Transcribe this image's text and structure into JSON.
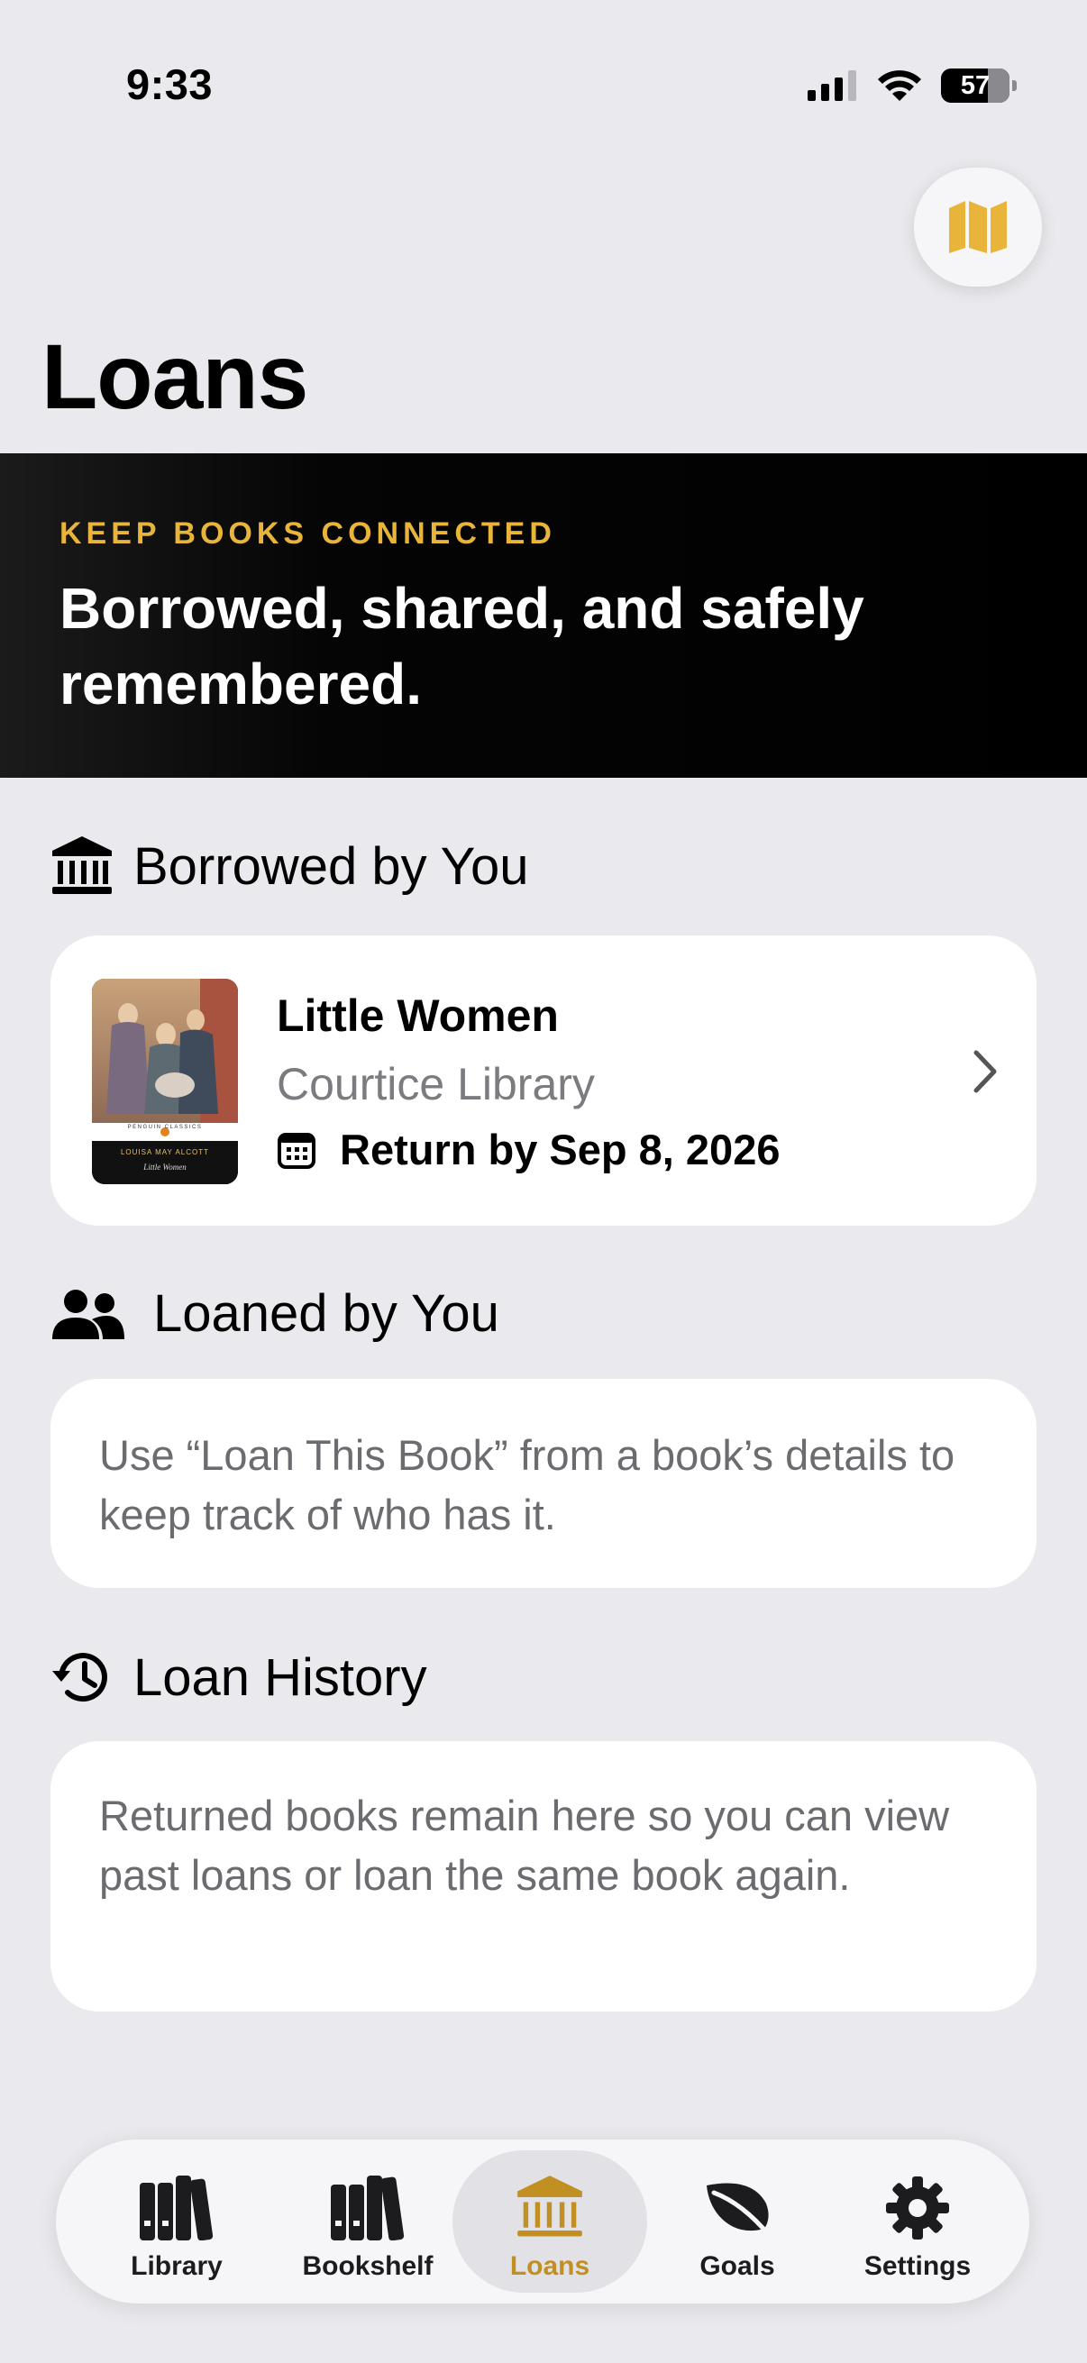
{
  "status_bar": {
    "time": "9:33",
    "battery": "57"
  },
  "header": {
    "title": "Loans",
    "map_icon": "map-icon"
  },
  "hero": {
    "eyebrow": "KEEP BOOKS CONNECTED",
    "headline": "Borrowed, shared, and safely remembered."
  },
  "sections": {
    "borrowed": {
      "title": "Borrowed by You",
      "icon": "bank-icon",
      "items": [
        {
          "title": "Little Women",
          "library": "Courtice Library",
          "return_label": "Return by Sep 8, 2026",
          "cover_author": "LOUISA MAY ALCOTT",
          "cover_title": "Little Women",
          "cover_publisher": "PENGUIN CLASSICS"
        }
      ]
    },
    "loaned": {
      "title": "Loaned by You",
      "icon": "people-icon",
      "empty_text": "Use “Loan This Book” from a book’s details to keep track of who has it."
    },
    "history": {
      "title": "Loan History",
      "icon": "history-icon",
      "empty_text": "Returned books remain here so you can view past loans or loan the same book again."
    }
  },
  "tab_bar": {
    "tabs": [
      {
        "label": "Library",
        "icon": "books-icon"
      },
      {
        "label": "Bookshelf",
        "icon": "bookshelf-icon"
      },
      {
        "label": "Loans",
        "icon": "bank-icon",
        "active": true
      },
      {
        "label": "Goals",
        "icon": "leaf-icon"
      },
      {
        "label": "Settings",
        "icon": "gear-icon"
      }
    ]
  },
  "colors": {
    "accent": "#E8B53A",
    "accent_text": "#C18F22",
    "background": "#EAEAEE",
    "card": "#FFFFFF"
  }
}
